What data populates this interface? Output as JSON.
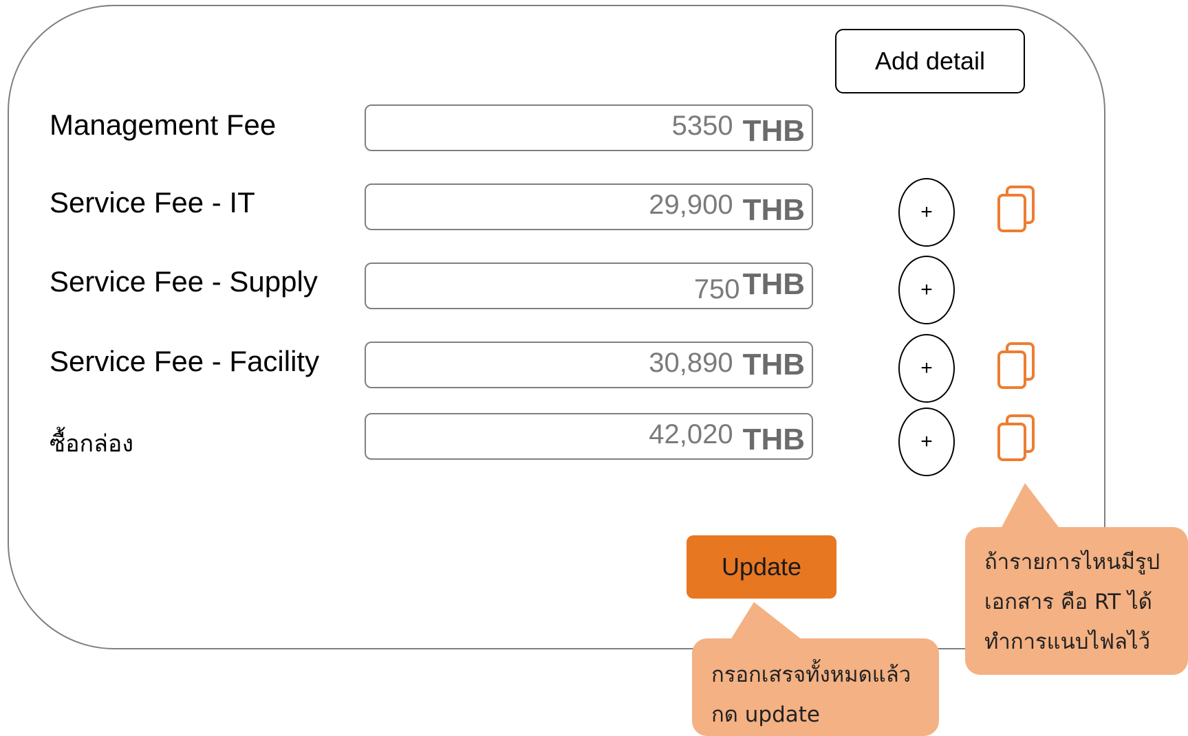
{
  "header": {
    "add_detail_label": "Add detail"
  },
  "rows": [
    {
      "label": "Management Fee",
      "value": "5350",
      "unit": "THB"
    },
    {
      "label": "Service Fee -  IT",
      "value": "29,900",
      "unit": "THB"
    },
    {
      "label": "Service Fee - Supply",
      "value": "750",
      "unit": "THB"
    },
    {
      "label": "Service Fee - Facility",
      "value": "30,890",
      "unit": "THB"
    },
    {
      "label": "ซื้อกล่อง",
      "value": "42,020",
      "unit": "THB"
    }
  ],
  "actions": {
    "plus_label": "+",
    "update_label": "Update"
  },
  "callouts": {
    "update_note": [
      "กรอกเสรจทั้งหมดแล้ว",
      "กด update"
    ],
    "document_note": [
      "ถ้ารายการไหนมีรูป",
      "เอกสาร คือ RT ได้",
      "ทำการแนบไฟลไว้"
    ]
  },
  "colors": {
    "accent": "#E87722",
    "callout": "#F4B183",
    "copy_icon": "#ED7D31",
    "border": "#7F7F7F"
  },
  "icons": {
    "copy": "copy-document-icon"
  }
}
